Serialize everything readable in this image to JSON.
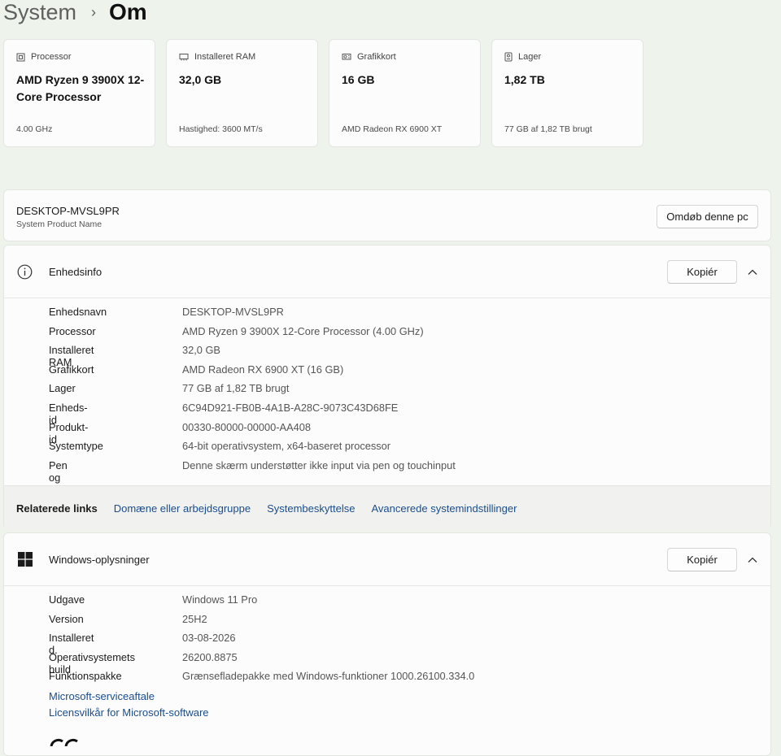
{
  "breadcrumb": {
    "parent": "System",
    "separator": "›",
    "current": "Om"
  },
  "specs": [
    {
      "label": "Processor",
      "value": "AMD Ryzen 9 3900X 12-Core Processor",
      "sub": "4.00 GHz",
      "icon": "processor-icon"
    },
    {
      "label": "Installeret RAM",
      "value": "32,0 GB",
      "sub": "Hastighed: 3600 MT/s",
      "icon": "ram-icon"
    },
    {
      "label": "Grafikkort",
      "value": "16 GB",
      "sub": "AMD Radeon RX 6900 XT",
      "icon": "graphics-card-icon"
    },
    {
      "label": "Lager",
      "value": "1,82 TB",
      "sub": "77 GB af 1,82 TB brugt",
      "icon": "storage-icon"
    }
  ],
  "device": {
    "name": "DESKTOP-MVSL9PR",
    "sub": "System Product Name",
    "rename_label": "Omdøb denne pc"
  },
  "device_info": {
    "title": "Enhedsinfo",
    "copy_label": "Kopiér",
    "rows": [
      {
        "key": "Enhedsnavn",
        "value": "DESKTOP-MVSL9PR"
      },
      {
        "key": "Processor",
        "value": "AMD Ryzen 9 3900X 12-Core Processor (4.00 GHz)"
      },
      {
        "key": "Installeret RAM",
        "value": "32,0 GB"
      },
      {
        "key": "Grafikkort",
        "value": "AMD Radeon RX 6900 XT (16 GB)"
      },
      {
        "key": "Lager",
        "value": "77 GB af 1,82 TB brugt"
      },
      {
        "key": "Enheds-id",
        "value": "6C94D921-FB0B-4A1B-A28C-9073C43D68FE"
      },
      {
        "key": "Produkt-id",
        "value": "00330-80000-00000-AA408"
      },
      {
        "key": "Systemtype",
        "value": "64-bit operativsystem, x64-baseret processor"
      },
      {
        "key": "Pen og touch",
        "value": "Denne skærm understøtter ikke input via pen og touchinput"
      }
    ]
  },
  "related": {
    "label": "Relaterede links",
    "links": [
      "Domæne eller arbejdsgruppe",
      "Systembeskyttelse",
      "Avancerede systemindstillinger"
    ]
  },
  "windows_info": {
    "title": "Windows-oplysninger",
    "copy_label": "Kopiér",
    "rows": [
      {
        "key": "Udgave",
        "value": "Windows 11 Pro"
      },
      {
        "key": "Version",
        "value": "25H2"
      },
      {
        "key": "Installeret d.",
        "value": "03-08-2026"
      },
      {
        "key": "Operativsystemets build",
        "value": "26200.8875"
      },
      {
        "key": "Funktionspakke",
        "value": "Grænsefladepakke med Windows-funktioner 1000.26100.334.0"
      }
    ],
    "links": [
      "Microsoft-serviceaftale",
      "Licensvilkår for Microsoft-software"
    ]
  }
}
